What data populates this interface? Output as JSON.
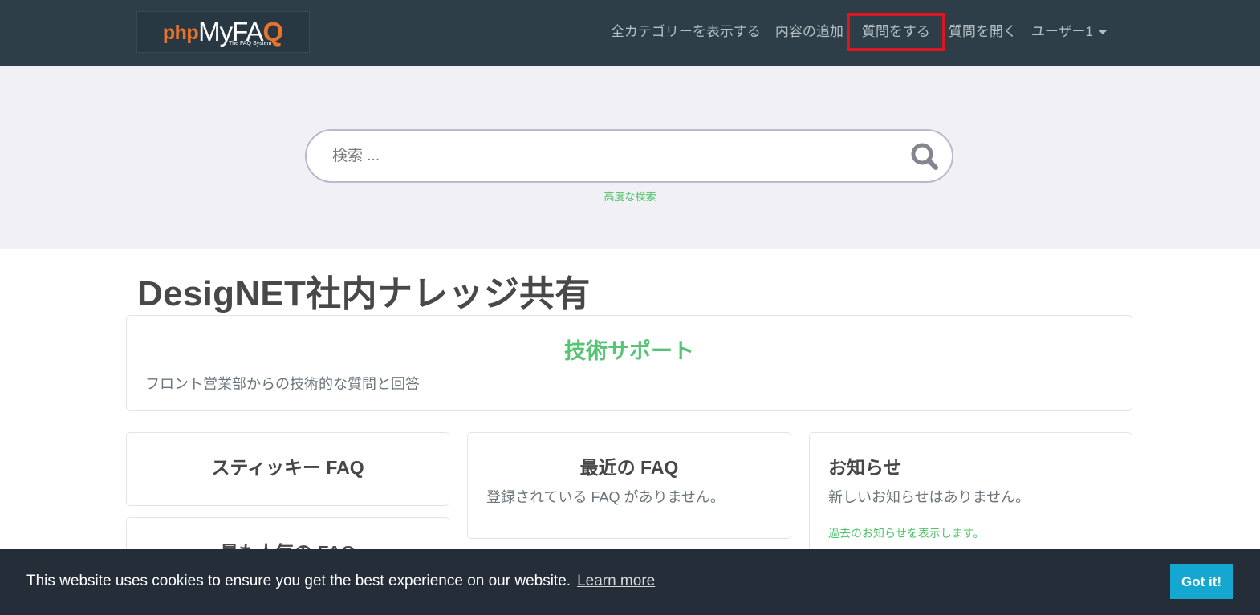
{
  "navbar": {
    "logo": {
      "php": "php",
      "my": "MyFA",
      "q": "Q",
      "subtitle": "The FAQ System"
    },
    "items": [
      {
        "label": "全カテゴリーを表示する"
      },
      {
        "label": "内容の追加"
      },
      {
        "label": "質問をする",
        "highlighted": true
      },
      {
        "label": "質問を開く"
      },
      {
        "label": "ユーザー1",
        "dropdown": true
      }
    ]
  },
  "search": {
    "placeholder": "検索 ...",
    "value": "",
    "button_icon": "search-icon",
    "advanced_label": "高度な検索"
  },
  "page": {
    "title": "DesigNET社内ナレッジ共有"
  },
  "category": {
    "title": "技術サポート",
    "description": "フロント営業部からの技術的な質問と回答"
  },
  "cards": {
    "sticky": {
      "title": "スティッキー FAQ"
    },
    "popular": {
      "title": "最も人気の FAQ"
    },
    "recent": {
      "title": "最近の FAQ",
      "message": "登録されている FAQ がありません。"
    },
    "news": {
      "title": "お知らせ",
      "message": "新しいお知らせはありません。",
      "archive_link": "過去のお知らせを表示します。"
    }
  },
  "cookie_banner": {
    "message": "This website uses cookies to ensure you get the best experience on our website.",
    "learn_more": "Learn more",
    "accept": "Got it!"
  },
  "colors": {
    "navbar_bg": "#2e3e48",
    "accent_green": "#57c475",
    "highlight_red": "#e0161e",
    "cookie_bg": "#252d39",
    "cookie_button": "#14a7d0"
  }
}
